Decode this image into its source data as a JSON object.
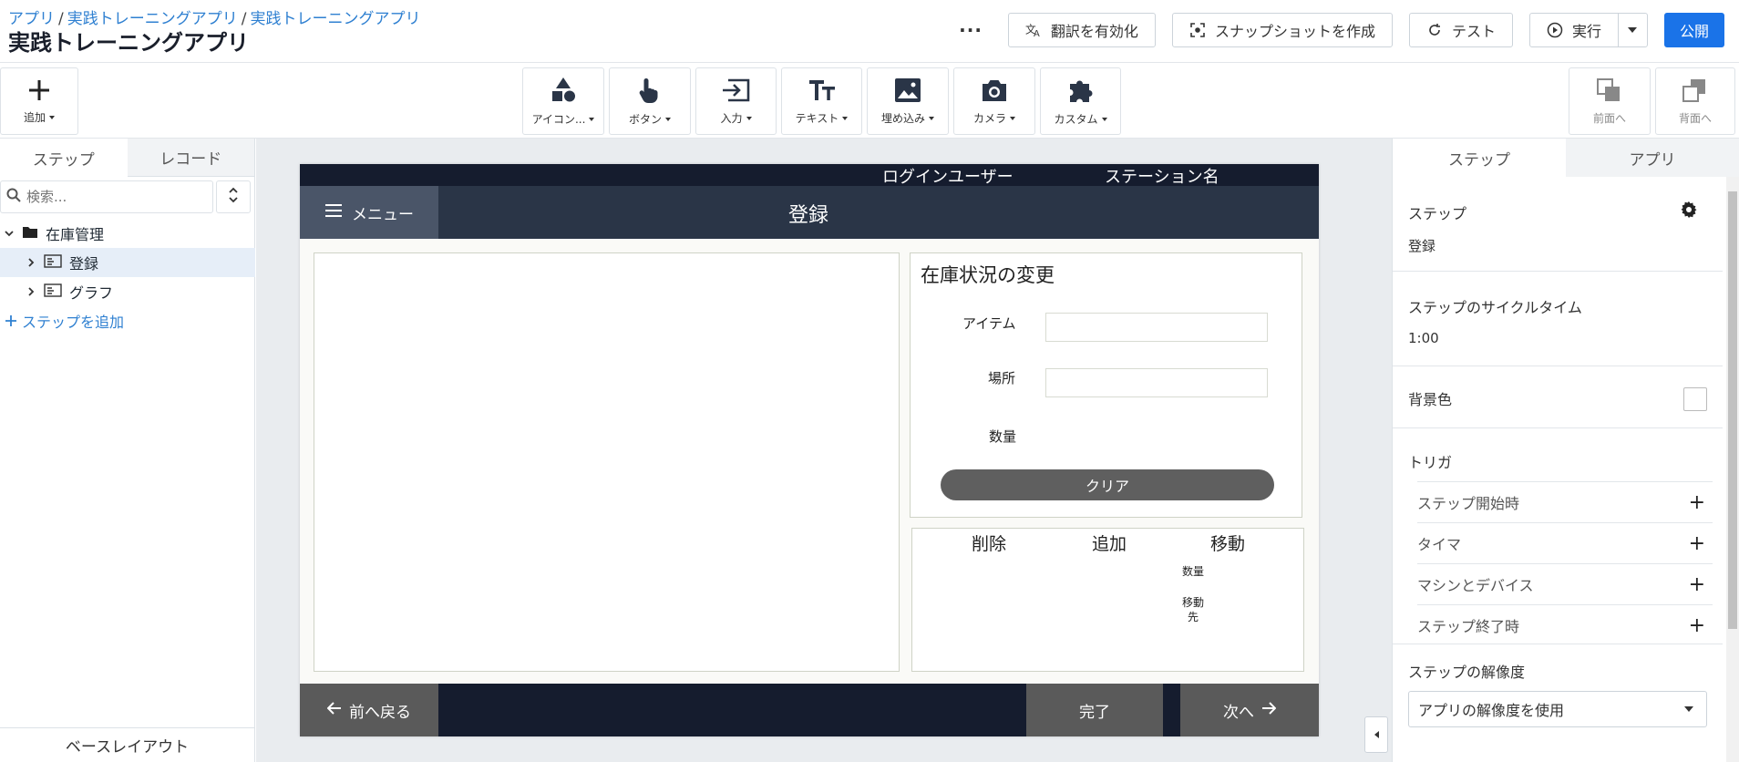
{
  "header": {
    "breadcrumb": [
      "アプリ",
      "実践トレーニングアプリ",
      "実践トレーニングアプリ"
    ],
    "separator": "/",
    "title": "実践トレーニングアプリ",
    "more_label": "···",
    "translate_label": "翻訳を有効化",
    "snapshot_label": "スナップショットを作成",
    "test_label": "テスト",
    "run_label": "実行",
    "publish_label": "公開"
  },
  "toolbar": {
    "add_label": "追加",
    "icons_label": "アイコン...",
    "button_label": "ボタン",
    "input_label": "入力",
    "text_label": "テキスト",
    "embed_label": "埋め込み",
    "camera_label": "カメラ",
    "custom_label": "カスタム",
    "forward_label": "前面へ",
    "backward_label": "背面へ"
  },
  "left_panel": {
    "tabs": [
      "ステップ",
      "レコード"
    ],
    "search_placeholder": "検索...",
    "tree": {
      "folder": "在庫管理",
      "items": [
        "登録",
        "グラフ"
      ]
    },
    "add_step_label": "ステップを追加",
    "base_layout_label": "ベースレイアウト"
  },
  "canvas": {
    "login_user": "ログインユーザー",
    "station_name": "ステーション名",
    "menu_label": "メニュー",
    "step_title": "登録",
    "form_title": "在庫状況の変更",
    "item_label": "アイテム",
    "location_label": "場所",
    "quantity_label": "数量",
    "clear_label": "クリア",
    "ops": [
      "削除",
      "追加",
      "移動"
    ],
    "op_quantity": "数量",
    "op_dest_line1": "移動",
    "op_dest_line2": "先",
    "back_label": "前へ戻る",
    "done_label": "完了",
    "next_label": "次へ"
  },
  "right_panel": {
    "tabs": [
      "ステップ",
      "アプリ"
    ],
    "step_title": "ステップ",
    "step_name": "登録",
    "cycle_title": "ステップのサイクルタイム",
    "cycle_value": "1:00",
    "bg_color_title": "背景色",
    "trigger_title": "トリガ",
    "triggers": [
      "ステップ開始時",
      "タイマ",
      "マシンとデバイス",
      "ステップ終了時"
    ],
    "resolution_title": "ステップの解像度",
    "resolution_value": "アプリの解像度を使用"
  },
  "colors": {
    "accent": "#1a73e8",
    "link": "#2f80d1",
    "app_dark": "#151c2e",
    "app_title_bar": "#2a3547",
    "button_gray": "#5a5a5a"
  }
}
